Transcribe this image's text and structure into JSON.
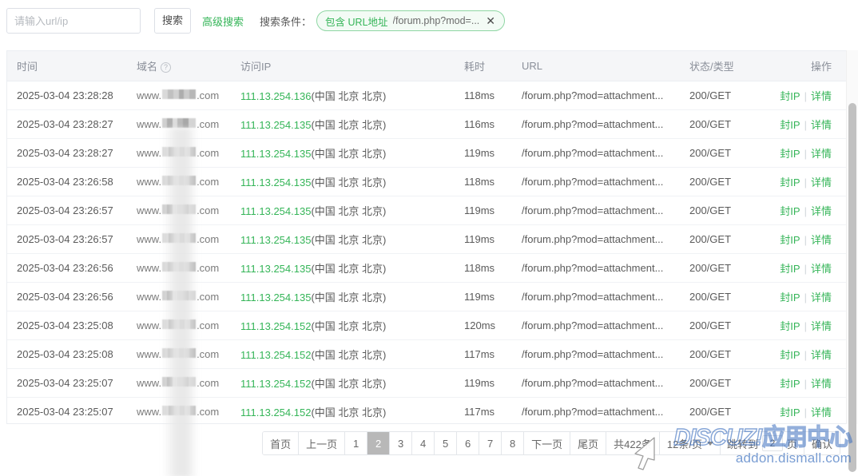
{
  "toolbar": {
    "search_placeholder": "请输入url/ip",
    "search_value": "",
    "search_button": "搜索",
    "advanced_search": "高级搜索",
    "condition_label": "搜索条件：",
    "condition_tag": {
      "key": "包含 URL地址",
      "value": "/forum.php?mod=...",
      "close": "✕"
    }
  },
  "table": {
    "columns": {
      "time": "时间",
      "domain": "域名",
      "domain_help": "?",
      "ip": "访问IP",
      "cost": "耗时",
      "url": "URL",
      "status": "状态/类型",
      "action": "操作"
    },
    "action_labels": {
      "ban": "封IP",
      "detail": "详情",
      "separator": "|"
    },
    "rows": [
      {
        "time": "2025-03-04 23:28:28",
        "domain_prefix": "www.",
        "domain_suffix": ".com",
        "ip": "111.13.254.136",
        "geo": "(中国 北京 北京)",
        "cost": "118ms",
        "url": "/forum.php?mod=attachment...",
        "status": "200/GET"
      },
      {
        "time": "2025-03-04 23:28:27",
        "domain_prefix": "www.",
        "domain_suffix": ".com",
        "ip": "111.13.254.135",
        "geo": "(中国 北京 北京)",
        "cost": "116ms",
        "url": "/forum.php?mod=attachment...",
        "status": "200/GET"
      },
      {
        "time": "2025-03-04 23:28:27",
        "domain_prefix": "www.",
        "domain_suffix": ".com",
        "ip": "111.13.254.135",
        "geo": "(中国 北京 北京)",
        "cost": "119ms",
        "url": "/forum.php?mod=attachment...",
        "status": "200/GET"
      },
      {
        "time": "2025-03-04 23:26:58",
        "domain_prefix": "www.",
        "domain_suffix": ".com",
        "ip": "111.13.254.135",
        "geo": "(中国 北京 北京)",
        "cost": "118ms",
        "url": "/forum.php?mod=attachment...",
        "status": "200/GET"
      },
      {
        "time": "2025-03-04 23:26:57",
        "domain_prefix": "www.",
        "domain_suffix": ".com",
        "ip": "111.13.254.135",
        "geo": "(中国 北京 北京)",
        "cost": "119ms",
        "url": "/forum.php?mod=attachment...",
        "status": "200/GET"
      },
      {
        "time": "2025-03-04 23:26:57",
        "domain_prefix": "www.",
        "domain_suffix": ".com",
        "ip": "111.13.254.135",
        "geo": "(中国 北京 北京)",
        "cost": "119ms",
        "url": "/forum.php?mod=attachment...",
        "status": "200/GET"
      },
      {
        "time": "2025-03-04 23:26:56",
        "domain_prefix": "www.",
        "domain_suffix": ".com",
        "ip": "111.13.254.135",
        "geo": "(中国 北京 北京)",
        "cost": "118ms",
        "url": "/forum.php?mod=attachment...",
        "status": "200/GET"
      },
      {
        "time": "2025-03-04 23:26:56",
        "domain_prefix": "www.",
        "domain_suffix": ".com",
        "ip": "111.13.254.135",
        "geo": "(中国 北京 北京)",
        "cost": "119ms",
        "url": "/forum.php?mod=attachment...",
        "status": "200/GET"
      },
      {
        "time": "2025-03-04 23:25:08",
        "domain_prefix": "www.",
        "domain_suffix": ".com",
        "ip": "111.13.254.152",
        "geo": "(中国 北京 北京)",
        "cost": "120ms",
        "url": "/forum.php?mod=attachment...",
        "status": "200/GET"
      },
      {
        "time": "2025-03-04 23:25:08",
        "domain_prefix": "www.",
        "domain_suffix": ".com",
        "ip": "111.13.254.152",
        "geo": "(中国 北京 北京)",
        "cost": "117ms",
        "url": "/forum.php?mod=attachment...",
        "status": "200/GET"
      },
      {
        "time": "2025-03-04 23:25:07",
        "domain_prefix": "www.",
        "domain_suffix": ".com",
        "ip": "111.13.254.152",
        "geo": "(中国 北京 北京)",
        "cost": "119ms",
        "url": "/forum.php?mod=attachment...",
        "status": "200/GET"
      },
      {
        "time": "2025-03-04 23:25:07",
        "domain_prefix": "www.",
        "domain_suffix": ".com",
        "ip": "111.13.254.152",
        "geo": "(中国 北京 北京)",
        "cost": "117ms",
        "url": "/forum.php?mod=attachment...",
        "status": "200/GET"
      }
    ]
  },
  "pagination": {
    "first": "首页",
    "prev": "上一页",
    "pages": [
      "1",
      "2",
      "3",
      "4",
      "5",
      "6",
      "7",
      "8"
    ],
    "current": "2",
    "next": "下一页",
    "last": "尾页",
    "total": "共422条",
    "page_size": "12条/页",
    "jump_prefix": "跳转到",
    "jump_value": "2",
    "jump_suffix": "页",
    "confirm": "确认"
  },
  "watermark": {
    "brand": "DISCUZ!",
    "brand_cn": "应用中心",
    "site": "addon.dismall.com"
  },
  "colors": {
    "accent_green": "#35b558",
    "header_bg": "#f5f6f8",
    "border": "#ebeef2",
    "active_page": "#b8b8b8",
    "watermark_blue": "#3a6ebe"
  }
}
